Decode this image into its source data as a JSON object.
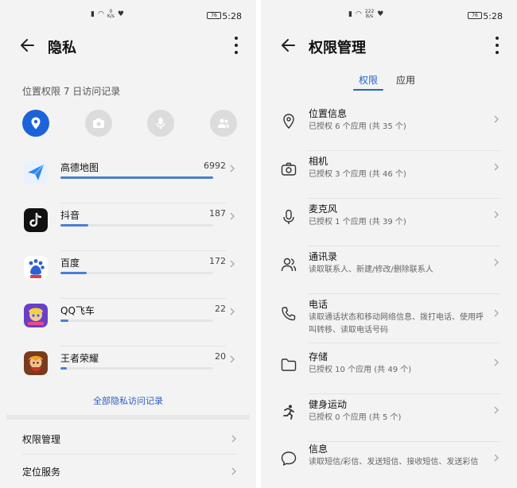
{
  "left": {
    "status": {
      "speed": "0\nK/s",
      "battery": "76",
      "time": "5:28"
    },
    "header": {
      "title": "隐私"
    },
    "section_label": "位置权限 7 日访问记录",
    "category_icons": [
      "location-icon",
      "camera-icon",
      "microphone-icon",
      "contacts-icon"
    ],
    "apps": [
      {
        "name": "高德地图",
        "count": "6992",
        "progress": 1.0,
        "icon": "amap-icon",
        "color": "#2f86f0"
      },
      {
        "name": "抖音",
        "count": "187",
        "progress": 0.18,
        "icon": "douyin-icon",
        "color": "#111111"
      },
      {
        "name": "百度",
        "count": "172",
        "progress": 0.17,
        "icon": "baidu-icon",
        "color": "#2e5fd6"
      },
      {
        "name": "QQ飞车",
        "count": "22",
        "progress": 0.05,
        "icon": "qq-speed-icon",
        "color": "#7b3fd1"
      },
      {
        "name": "王者荣耀",
        "count": "20",
        "progress": 0.04,
        "icon": "honor-of-kings-icon",
        "color": "#c47a3a"
      }
    ],
    "all_records": "全部隐私访问记录",
    "menu": [
      {
        "label": "权限管理"
      },
      {
        "label": "定位服务"
      }
    ]
  },
  "right": {
    "status": {
      "speed": "222\nB/s",
      "battery": "76",
      "time": "5:28"
    },
    "header": {
      "title": "权限管理"
    },
    "tabs": [
      {
        "label": "权限",
        "active": true
      },
      {
        "label": "应用",
        "active": false
      }
    ],
    "permissions": [
      {
        "title": "位置信息",
        "sub": "已授权 6 个应用 (共 35 个)",
        "icon": "location-pin-icon"
      },
      {
        "title": "相机",
        "sub": "已授权 3 个应用 (共 46 个)",
        "icon": "camera-icon"
      },
      {
        "title": "麦克风",
        "sub": "已授权 1 个应用 (共 39 个)",
        "icon": "microphone-icon"
      },
      {
        "title": "通讯录",
        "sub": "读取联系人、新建/修改/删除联系人",
        "icon": "contacts-icon"
      },
      {
        "title": "电话",
        "sub": "读取通话状态和移动网络信息、拨打电话、使用呼叫转移、读取电话号码",
        "icon": "phone-icon"
      },
      {
        "title": "存储",
        "sub": "已授权 10 个应用 (共 49 个)",
        "icon": "folder-icon"
      },
      {
        "title": "健身运动",
        "sub": "已授权 0 个应用 (共 5 个)",
        "icon": "running-icon"
      },
      {
        "title": "信息",
        "sub": "读取短信/彩信、发送短信、接收短信、发送彩信",
        "icon": "message-icon"
      }
    ]
  },
  "colors": {
    "accent": "#1c63d8",
    "link": "#2a5bc9",
    "background": "#f3f3f3"
  }
}
